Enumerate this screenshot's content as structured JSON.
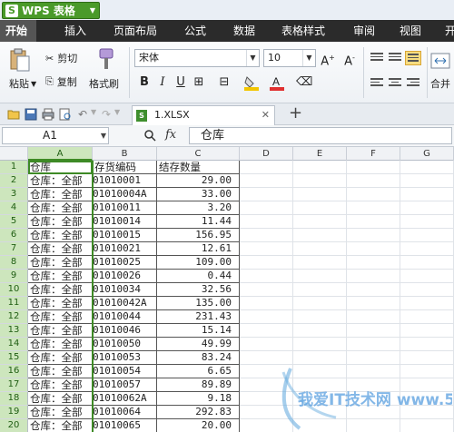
{
  "app": {
    "title": "WPS 表格",
    "logo_letter": "S"
  },
  "menu": {
    "tabs": [
      "开始",
      "插入",
      "页面布局",
      "公式",
      "数据",
      "表格样式",
      "审阅",
      "视图",
      "开"
    ]
  },
  "ribbon": {
    "paste_label": "粘贴",
    "cut_label": "剪切",
    "copy_label": "复制",
    "format_painter_label": "格式刷",
    "font_name": "宋体",
    "font_size": "10",
    "bold": "B",
    "italic": "I",
    "underline": "U",
    "merge_label": "合并",
    "increase_font": "A+",
    "decrease_font": "A-"
  },
  "file_tab": {
    "name": "1.XLSX",
    "close": "✕"
  },
  "formula_bar": {
    "cell_ref": "A1",
    "fx_label": "fx",
    "value": "仓库"
  },
  "columns": [
    "A",
    "B",
    "C",
    "D",
    "E",
    "F",
    "G"
  ],
  "sheet": {
    "header": [
      "仓库",
      "存货编码",
      "结存数量"
    ],
    "rows": [
      [
        "仓库：全部",
        "01010001",
        "29.00"
      ],
      [
        "仓库：全部",
        "01010004A",
        "33.00"
      ],
      [
        "仓库：全部",
        "01010011",
        "3.20"
      ],
      [
        "仓库：全部",
        "01010014",
        "11.44"
      ],
      [
        "仓库：全部",
        "01010015",
        "156.95"
      ],
      [
        "仓库：全部",
        "01010021",
        "12.61"
      ],
      [
        "仓库：全部",
        "01010025",
        "109.00"
      ],
      [
        "仓库：全部",
        "01010026",
        "0.44"
      ],
      [
        "仓库：全部",
        "01010034",
        "32.56"
      ],
      [
        "仓库：全部",
        "01010042A",
        "135.00"
      ],
      [
        "仓库：全部",
        "01010044",
        "231.43"
      ],
      [
        "仓库：全部",
        "01010046",
        "15.14"
      ],
      [
        "仓库：全部",
        "01010050",
        "49.99"
      ],
      [
        "仓库：全部",
        "01010053",
        "83.24"
      ],
      [
        "仓库：全部",
        "01010054",
        "6.65"
      ],
      [
        "仓库：全部",
        "01010057",
        "89.89"
      ],
      [
        "仓库：全部",
        "01010062A",
        "9.18"
      ],
      [
        "仓库：全部",
        "01010064",
        "292.83"
      ],
      [
        "仓库：全部",
        "01010065",
        "20.00"
      ]
    ]
  },
  "watermark": "我爱IT技术网 www.52ij.com",
  "colors": {
    "accent_green": "#4a9a2a",
    "menu_bg": "#2b2b2b",
    "selection_green": "#cde6bd"
  }
}
